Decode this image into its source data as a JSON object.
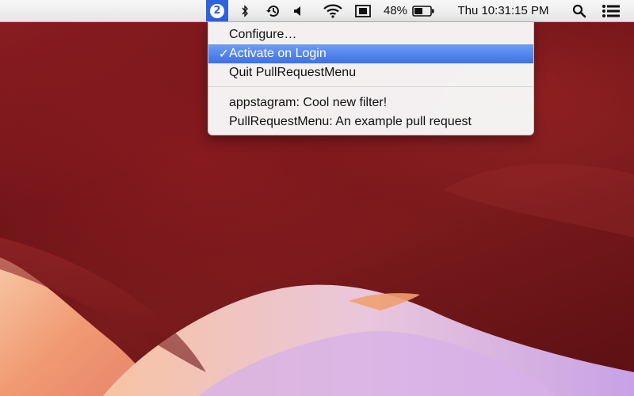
{
  "menubar": {
    "app_badge": "2",
    "icons": [
      "bluetooth-icon",
      "time-machine-icon",
      "volume-icon",
      "wifi-icon",
      "display-icon",
      "battery-icon",
      "spotlight-icon",
      "notification-center-icon"
    ],
    "battery_percent": "48%",
    "clock": "Thu 10:31:15 PM"
  },
  "menu": {
    "items": [
      {
        "label": "Configure…",
        "checked": false
      },
      {
        "label": "Activate on Login",
        "checked": true
      },
      {
        "label": "Quit PullRequestMenu",
        "checked": false
      }
    ],
    "pull_requests": [
      {
        "label": "appstagram: Cool new filter!"
      },
      {
        "label": "PullRequestMenu: An example pull request"
      }
    ],
    "checkmark": "✓"
  },
  "colors": {
    "highlight": "#3b71e6",
    "wallpaper_dark": "#6e1418",
    "wallpaper_light": "#f3a88c"
  }
}
